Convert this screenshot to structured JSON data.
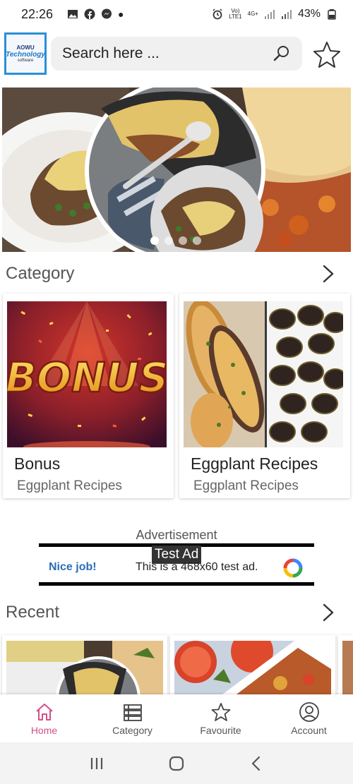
{
  "status_bar": {
    "time": "22:26",
    "network_top": "Vo)",
    "network_bottom": "LTE1",
    "net_type": "4G+",
    "battery": "43%"
  },
  "header": {
    "logo_line1": "AOWU",
    "logo_line2": "Technology",
    "logo_line3": "software",
    "search_placeholder": "Search here ..."
  },
  "banner": {
    "slide_count": 4,
    "active_index": 0
  },
  "category_section": {
    "title": "Category",
    "items": [
      {
        "name": "Bonus",
        "subtitle": "Eggplant Recipes",
        "thumb_text": "BONUS"
      },
      {
        "name": "Eggplant Recipes",
        "subtitle": "Eggplant Recipes"
      }
    ]
  },
  "advertisement": {
    "label": "Advertisement",
    "badge": "Test Ad",
    "headline": "Nice job!",
    "description": "This is a 468x60 test ad."
  },
  "recent_section": {
    "title": "Recent"
  },
  "bottom_nav": {
    "items": [
      {
        "label": "Home",
        "icon": "home-icon",
        "active": true
      },
      {
        "label": "Category",
        "icon": "category-icon",
        "active": false
      },
      {
        "label": "Favourite",
        "icon": "star-icon",
        "active": false
      },
      {
        "label": "Account",
        "icon": "account-icon",
        "active": false
      }
    ]
  },
  "colors": {
    "accent": "#d2508a",
    "logo_border": "#2a8fd8",
    "search_bg": "#f0f0f0"
  }
}
